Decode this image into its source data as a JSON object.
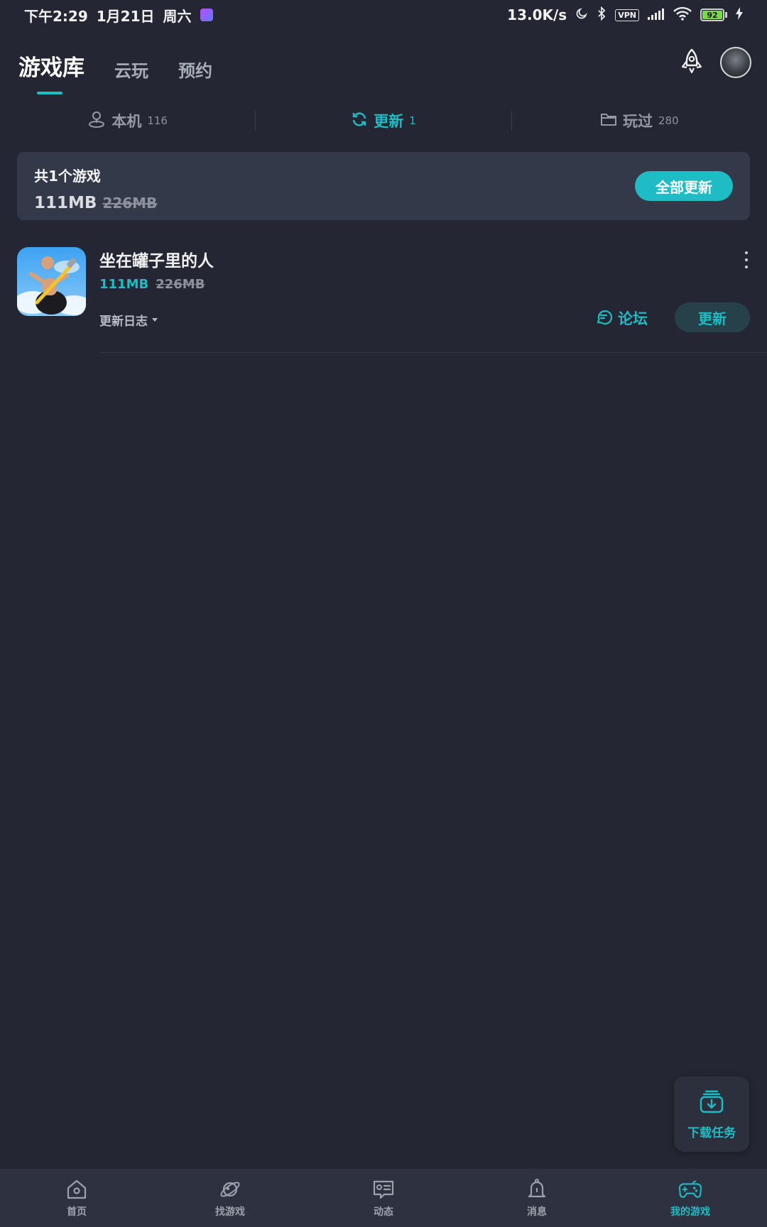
{
  "status_bar": {
    "time": "下午2:29",
    "date": "1月21日",
    "weekday": "周六",
    "net_speed": "13.0K/s",
    "vpn": "VPN",
    "battery": "92"
  },
  "header": {
    "tabs": [
      {
        "label": "游戏库",
        "active": true
      },
      {
        "label": "云玩",
        "active": false
      },
      {
        "label": "预约",
        "active": false
      }
    ]
  },
  "sub_tabs": [
    {
      "label": "本机",
      "count": "116",
      "icon": "person-pin-icon",
      "active": false
    },
    {
      "label": "更新",
      "count": "1",
      "icon": "refresh-icon",
      "active": true
    },
    {
      "label": "玩过",
      "count": "280",
      "icon": "folder-icon",
      "active": false
    }
  ],
  "summary": {
    "title": "共1个游戏",
    "new_size": "111MB",
    "old_size": "226MB",
    "button": "全部更新"
  },
  "games": [
    {
      "title": "坐在罐子里的人",
      "new_size": "111MB",
      "old_size": "226MB",
      "changelog": "更新日志",
      "forum": "论坛",
      "update": "更新"
    }
  ],
  "download_task": {
    "label": "下载任务"
  },
  "bottom_nav": [
    {
      "label": "首页",
      "icon": "home-icon",
      "active": false
    },
    {
      "label": "找游戏",
      "icon": "planet-icon",
      "active": false
    },
    {
      "label": "动态",
      "icon": "feed-icon",
      "active": false
    },
    {
      "label": "消息",
      "icon": "bell-icon",
      "active": false
    },
    {
      "label": "我的游戏",
      "icon": "gamepad-icon",
      "active": true
    }
  ],
  "colors": {
    "accent": "#1fbcc6",
    "background": "#242733",
    "card": "#333948"
  }
}
